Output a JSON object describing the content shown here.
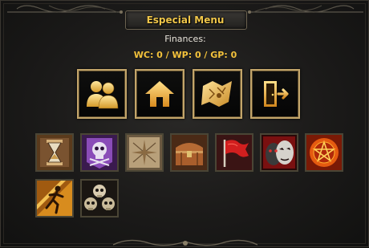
{
  "menu": {
    "title": "Especial Menu",
    "finances_label": "Finances:",
    "finances_value": "WC: 0 / WP: 0 / GP: 0"
  },
  "buttons": [
    {
      "name": "party-button",
      "icon": "party-icon"
    },
    {
      "name": "home-button",
      "icon": "house-icon"
    },
    {
      "name": "teleport-map-button",
      "icon": "map-scroll-icon"
    },
    {
      "name": "exit-button",
      "icon": "exit-door-icon"
    }
  ],
  "skills_row1": [
    {
      "name": "hourglass-skill",
      "icon": "hourglass-icon"
    },
    {
      "name": "purple-skull-skill",
      "icon": "skull-banner-icon"
    },
    {
      "name": "map-skill",
      "icon": "map-icon"
    },
    {
      "name": "chest-skill",
      "icon": "chest-icon"
    },
    {
      "name": "flag-skill",
      "icon": "red-flag-icon"
    },
    {
      "name": "masks-skill",
      "icon": "masks-icon"
    },
    {
      "name": "pentagram-skill",
      "icon": "pentagram-icon"
    }
  ],
  "skills_row2": [
    {
      "name": "running-man-skill",
      "icon": "running-man-icon"
    },
    {
      "name": "skulls-skill",
      "icon": "skull-pile-icon"
    }
  ],
  "colors": {
    "title": "#f0c64a",
    "finances_value": "#f3c23b",
    "button_border": "#c3a56a"
  }
}
